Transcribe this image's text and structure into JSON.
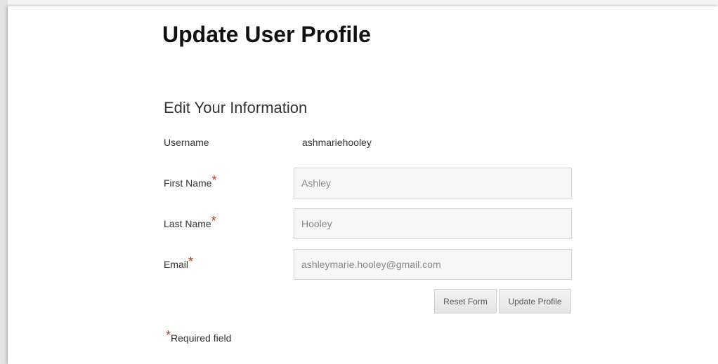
{
  "page": {
    "title": "Update User Profile"
  },
  "form": {
    "section_title": "Edit Your Information",
    "required_mark": "*",
    "username": {
      "label": "Username",
      "value": "ashmariehooley"
    },
    "first_name": {
      "label": "First Name",
      "value": "Ashley"
    },
    "last_name": {
      "label": "Last Name",
      "value": "Hooley"
    },
    "email": {
      "label": "Email",
      "value": "ashleymarie.hooley@gmail.com"
    },
    "buttons": {
      "reset_label": "Reset Form",
      "update_label": "Update Profile"
    },
    "required_note": "Required field"
  },
  "colors": {
    "required_star": "#b5391f",
    "field_background": "#f7f7f7",
    "field_border": "#d4d4d4",
    "text": "#333333"
  }
}
